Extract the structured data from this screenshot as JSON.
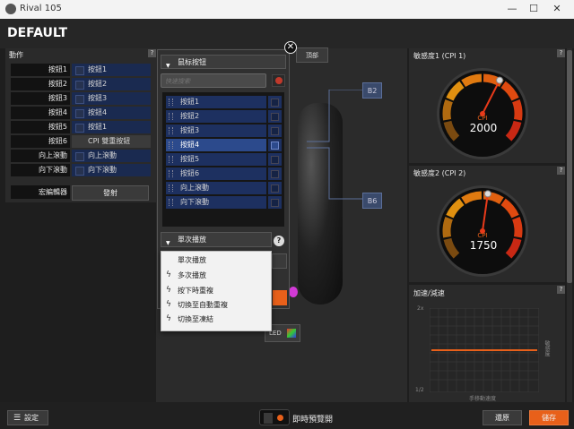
{
  "window": {
    "title": "Rival 105",
    "min": "—",
    "max": "☐",
    "close": "✕"
  },
  "profile": {
    "title": "DEFAULT"
  },
  "actions": {
    "title": "動作",
    "help": "?",
    "rows": [
      {
        "label": "按鈕1",
        "value": "按鈕1"
      },
      {
        "label": "按鈕2",
        "value": "按鈕2"
      },
      {
        "label": "按鈕3",
        "value": "按鈕3"
      },
      {
        "label": "按鈕4",
        "value": "按鈕4"
      },
      {
        "label": "按鈕5",
        "value": "按鈕1"
      },
      {
        "label": "按鈕6",
        "value": "CPI 雙重按鈕"
      },
      {
        "label": "向上滾動",
        "value": "向上滾動"
      },
      {
        "label": "向下滾動",
        "value": "向下滾動"
      }
    ],
    "macro_label": "宏編輯器",
    "macro_button": "發射"
  },
  "center": {
    "callout_top": "B2",
    "callout_bottom": "B6",
    "top_button": "頂部",
    "led": "LED"
  },
  "popup": {
    "close": "✕",
    "dropdown": "鼠标按钮",
    "search_placeholder": "快速搜索",
    "items": [
      "按鈕1",
      "按鈕2",
      "按鈕3",
      "按鈕4",
      "按鈕5",
      "按鈕6",
      "向上滾動",
      "向下滾動"
    ],
    "selected_index": 3,
    "play_mode": "單次播放",
    "play_help": "?",
    "play_options": [
      "單次播放",
      "多次播放",
      "按下時重複",
      "切換至自動重複",
      "切換至凍結"
    ]
  },
  "sensitivity1": {
    "label": "敏感度1 (CPI 1)",
    "cpi_label": "CPI",
    "value": "2000",
    "help": "?",
    "fraction": 0.6
  },
  "sensitivity2": {
    "label": "敏感度2 (CPI 2)",
    "cpi_label": "CPI",
    "value": "1750",
    "help": "?",
    "fraction": 0.53
  },
  "accel": {
    "label": "加速/減速",
    "help": "?",
    "y_top": "2x",
    "y_bottom": "1/2",
    "y_axis": "敏感度",
    "x_axis": "手移動速度"
  },
  "bottom": {
    "config_button": "設定",
    "live_preview": "即時預覽開",
    "revert_button": "還原",
    "save_button": "儲存"
  },
  "colors": {
    "accent": "#e8601a",
    "selection": "#2c4a8c",
    "list": "#1d3060"
  },
  "icons": {
    "config": "list-icon",
    "play_item": "bolt-icon"
  }
}
